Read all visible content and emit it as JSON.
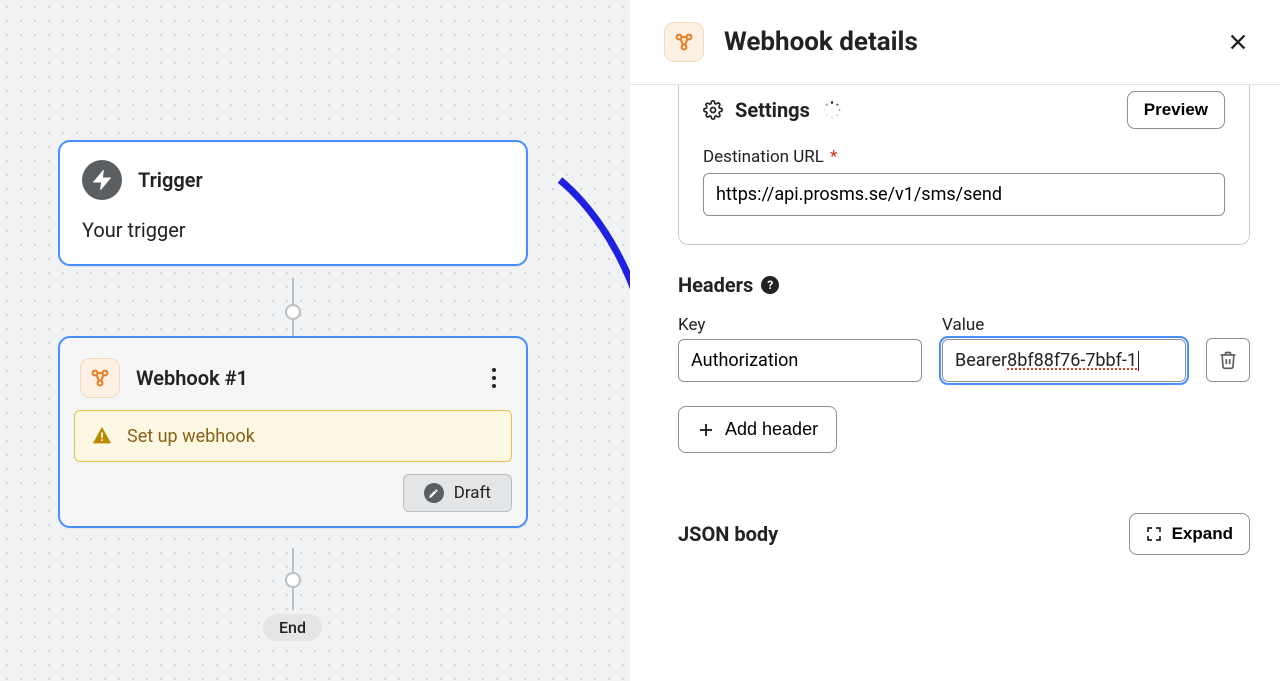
{
  "canvas": {
    "trigger": {
      "title": "Trigger",
      "subtitle": "Your trigger"
    },
    "webhook": {
      "title": "Webhook #1",
      "warning": "Set up webhook",
      "draft": "Draft"
    },
    "end": "End"
  },
  "panel": {
    "title": "Webhook details",
    "settings_label": "Settings",
    "preview": "Preview",
    "dest_url_label": "Destination URL",
    "dest_url_value": "https://api.prosms.se/v1/sms/send",
    "headers_label": "Headers",
    "key_label": "Key",
    "value_label": "Value",
    "header_key": "Authorization",
    "header_value_prefix": "Bearer ",
    "header_value_token": "8bf88f76-7bbf-1",
    "add_header": "Add header",
    "json_body_label": "JSON body",
    "expand": "Expand"
  }
}
